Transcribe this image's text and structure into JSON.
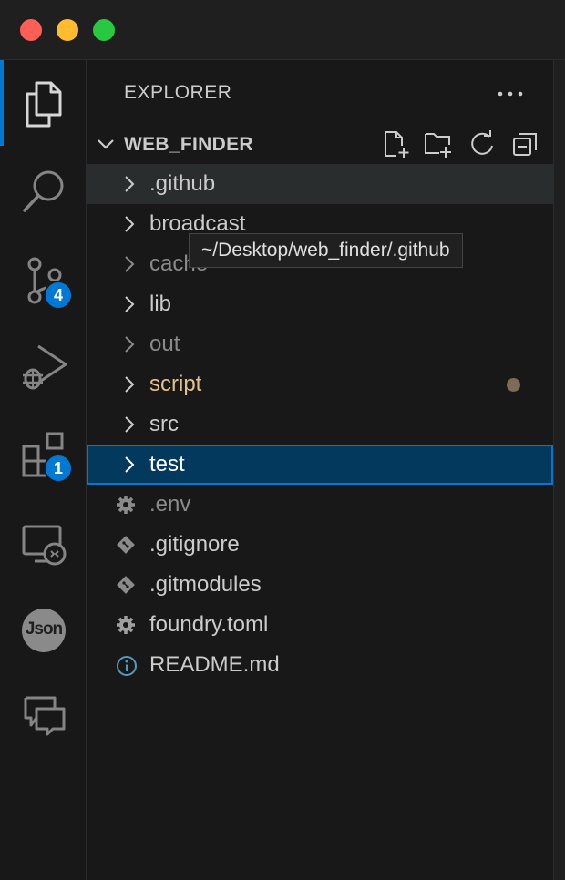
{
  "explorer": {
    "title": "EXPLORER",
    "folder_name": "WEB_FINDER",
    "tooltip": "~/Desktop/web_finder/.github"
  },
  "activity_bar": {
    "source_control_badge": "4",
    "extensions_badge": "1",
    "json_label": "Json"
  },
  "tree": [
    {
      "name": ".github",
      "type": "folder",
      "state": "hover"
    },
    {
      "name": "broadcast",
      "type": "folder",
      "state": "normal"
    },
    {
      "name": "cache",
      "type": "folder",
      "state": "dim"
    },
    {
      "name": "lib",
      "type": "folder",
      "state": "normal"
    },
    {
      "name": "out",
      "type": "folder",
      "state": "dim"
    },
    {
      "name": "script",
      "type": "folder",
      "state": "modified"
    },
    {
      "name": "src",
      "type": "folder",
      "state": "normal"
    },
    {
      "name": "test",
      "type": "folder",
      "state": "selected"
    },
    {
      "name": ".env",
      "type": "file",
      "icon": "gear-icon",
      "state": "dim"
    },
    {
      "name": ".gitignore",
      "type": "file",
      "icon": "git-icon",
      "state": "normal"
    },
    {
      "name": ".gitmodules",
      "type": "file",
      "icon": "git-icon",
      "state": "normal"
    },
    {
      "name": "foundry.toml",
      "type": "file",
      "icon": "gear-icon",
      "state": "normal"
    },
    {
      "name": "README.md",
      "type": "file",
      "icon": "info-icon",
      "state": "normal"
    }
  ],
  "colors": {
    "accent": "#0078d4",
    "modified": "#e2c08d",
    "selected_bg": "#04395e"
  }
}
